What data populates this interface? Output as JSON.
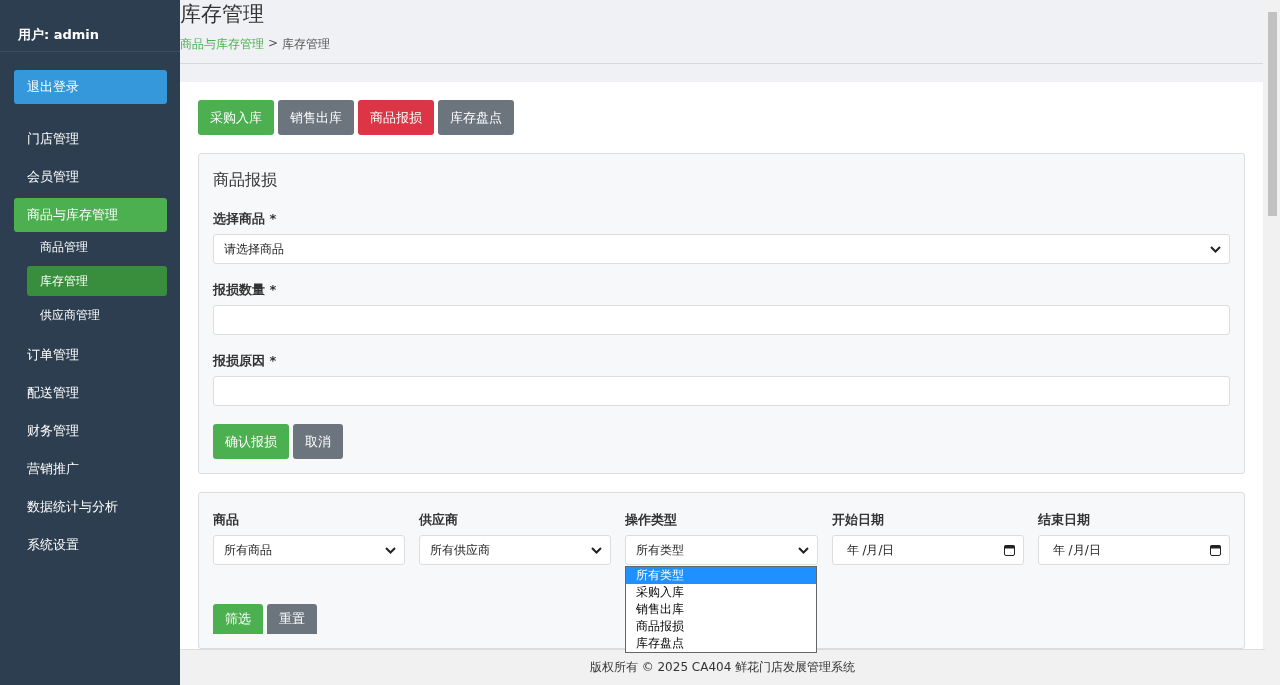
{
  "sidebar": {
    "user": "用户: admin",
    "logout": "退出登录",
    "items": [
      {
        "label": "门店管理",
        "selected": false
      },
      {
        "label": "会员管理",
        "selected": false
      },
      {
        "label": "商品与库存管理",
        "selected": true,
        "children": [
          {
            "label": "商品管理",
            "selected": false
          },
          {
            "label": "库存管理",
            "selected": true
          },
          {
            "label": "供应商管理",
            "selected": false
          }
        ]
      },
      {
        "label": "订单管理",
        "selected": false
      },
      {
        "label": "配送管理",
        "selected": false
      },
      {
        "label": "财务管理",
        "selected": false
      },
      {
        "label": "营销推广",
        "selected": false
      },
      {
        "label": "数据统计与分析",
        "selected": false
      },
      {
        "label": "系统设置",
        "selected": false
      }
    ]
  },
  "header": {
    "title": "库存管理",
    "breadcrumb": [
      {
        "label": "商品与库存管理",
        "kind": "link"
      },
      {
        "label": ">",
        "kind": "separator"
      },
      {
        "label": "库存管理",
        "kind": "current"
      }
    ]
  },
  "action_buttons": [
    {
      "label": "采购入库",
      "kind": "success"
    },
    {
      "label": "销售出库",
      "kind": "secondary"
    },
    {
      "label": "商品报损",
      "kind": "danger"
    },
    {
      "label": "库存盘点",
      "kind": "secondary"
    }
  ],
  "form": {
    "title": "商品报损",
    "fields": [
      {
        "label": "选择商品 *",
        "kind": "select",
        "value": "请选择商品"
      },
      {
        "label": "报损数量 *",
        "kind": "input"
      },
      {
        "label": "报损原因 *",
        "kind": "input"
      }
    ],
    "buttons": [
      {
        "label": "确认报损",
        "kind": "success"
      },
      {
        "label": "取消",
        "kind": "secondary"
      }
    ]
  },
  "filters": {
    "fields": [
      {
        "label": "商品",
        "kind": "select",
        "value": "所有商品"
      },
      {
        "label": "供应商",
        "kind": "select",
        "value": "所有供应商"
      },
      {
        "label": "操作类型",
        "kind": "select",
        "value": "所有类型",
        "options": [
          {
            "label": "所有类型",
            "selected": true
          },
          {
            "label": "采购入库",
            "selected": false
          },
          {
            "label": "销售出库",
            "selected": false
          },
          {
            "label": "商品报损",
            "selected": false
          },
          {
            "label": "库存盘点",
            "selected": false
          }
        ]
      },
      {
        "label": "开始日期",
        "kind": "date",
        "value": "年 /月/日"
      },
      {
        "label": "结束日期",
        "kind": "date",
        "value": "年 /月/日"
      }
    ],
    "buttons": [
      {
        "label": "筛选",
        "kind": "success"
      },
      {
        "label": "重置",
        "kind": "secondary"
      }
    ]
  },
  "footer": "版权所有 © 2025 CA404 鲜花门店发展管理系统"
}
